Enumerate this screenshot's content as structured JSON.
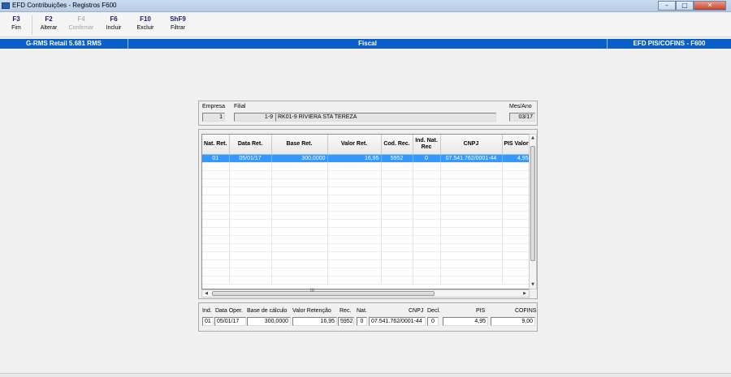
{
  "window": {
    "title": "EFD Contribuições - Registros F600",
    "buttons": {
      "minimize": "–",
      "maximize": "□",
      "close": "✕"
    }
  },
  "toolbar": {
    "buttons": [
      {
        "key": "F3",
        "label": "Fim",
        "enabled": true
      },
      {
        "key": "F2",
        "label": "Alterar",
        "enabled": true
      },
      {
        "key": "F4",
        "label": "Confirmar",
        "enabled": false
      },
      {
        "key": "F6",
        "label": "Incluir",
        "enabled": true
      },
      {
        "key": "F10",
        "label": "Excluir",
        "enabled": true
      },
      {
        "key": "ShF9",
        "label": "Filtrar",
        "enabled": true
      }
    ]
  },
  "status": {
    "system": "G-RMS Retail 5.681 RMS",
    "module": "Fiscal",
    "screen": "EFD PIS/COFINS - F600"
  },
  "header": {
    "empresa_label": "Empresa",
    "empresa_value": "1",
    "filial_label": "Filial",
    "filial_code": "1-9",
    "filial_name": "RK01-9 RIVIERA STA TEREZA",
    "mesano_label": "Mes/Ano",
    "mesano_value": "03/17"
  },
  "grid": {
    "columns": [
      "Nat. Ret.",
      "Data Ret.",
      "Base Ret.",
      "Valor Ret.",
      "Cod. Rec.",
      "Ind. Nat. Rec",
      "CNPJ",
      "PIS Valor"
    ],
    "rows": [
      {
        "nat_ret": "01",
        "data_ret": "05/01/17",
        "base_ret": "300,0000",
        "valor_ret": "16,95",
        "cod_rec": "5952",
        "ind_nat_rec": "0",
        "cnpj": "07.541.762/0001-44",
        "pis_valor": "4,95"
      }
    ],
    "scroll_grip": "III"
  },
  "detail": {
    "labels": {
      "ind": "Ind.",
      "data_oper": "Data Oper.",
      "base_calculo": "Base de cálculo",
      "valor_retencao": "Valor Retenção",
      "rec": "Rec.",
      "nat": "Nat.",
      "cnpj": "CNPJ",
      "decl": "Decl.",
      "pis": "PIS",
      "cofins": "COFINS"
    },
    "values": {
      "ind": "01",
      "data_oper": "05/01/17",
      "base_calculo": "300,0000",
      "valor_retencao": "16,95",
      "rec": "5952",
      "nat": "0",
      "cnpj": "07.541.762/0001-44",
      "decl": "0",
      "pis": "4,95",
      "cofins": "9,00"
    }
  }
}
